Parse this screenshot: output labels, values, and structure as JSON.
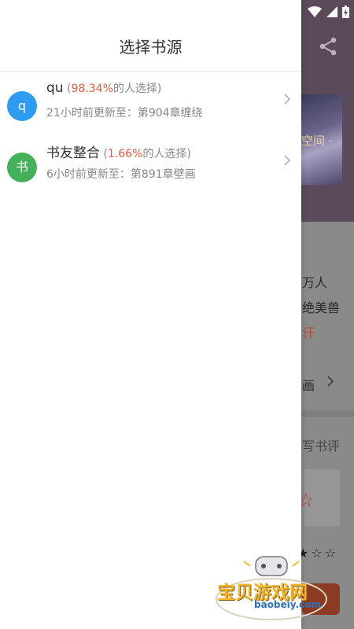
{
  "drawer": {
    "title": "选择书源",
    "sources": [
      {
        "avatar": "q",
        "avatar_color": "#2e9cf0",
        "name": "qu",
        "pct_open": " (",
        "pct": "98.34%",
        "pct_close": "的人选择)",
        "update": "21小时前更新至：第904章缠绕"
      },
      {
        "avatar": "书",
        "avatar_color": "#45b05a",
        "name": "书友整合",
        "pct_open": " (",
        "pct": "1.66%",
        "pct_close": "的人选择)",
        "update": "6小时前更新至：第891章壁画"
      }
    ]
  },
  "background": {
    "cover_text": "空间\n·",
    "readers": "万人",
    "desc": "绝美兽",
    "link": "讦",
    "chapter": "画",
    "review": "写书评",
    "stars": "★☆☆"
  },
  "watermark": {
    "text": "宝贝游戏网",
    "url": "baobeiy.com"
  },
  "colors": {
    "accent_red": "#e5593a",
    "drawer_bg": "#ffffff"
  }
}
